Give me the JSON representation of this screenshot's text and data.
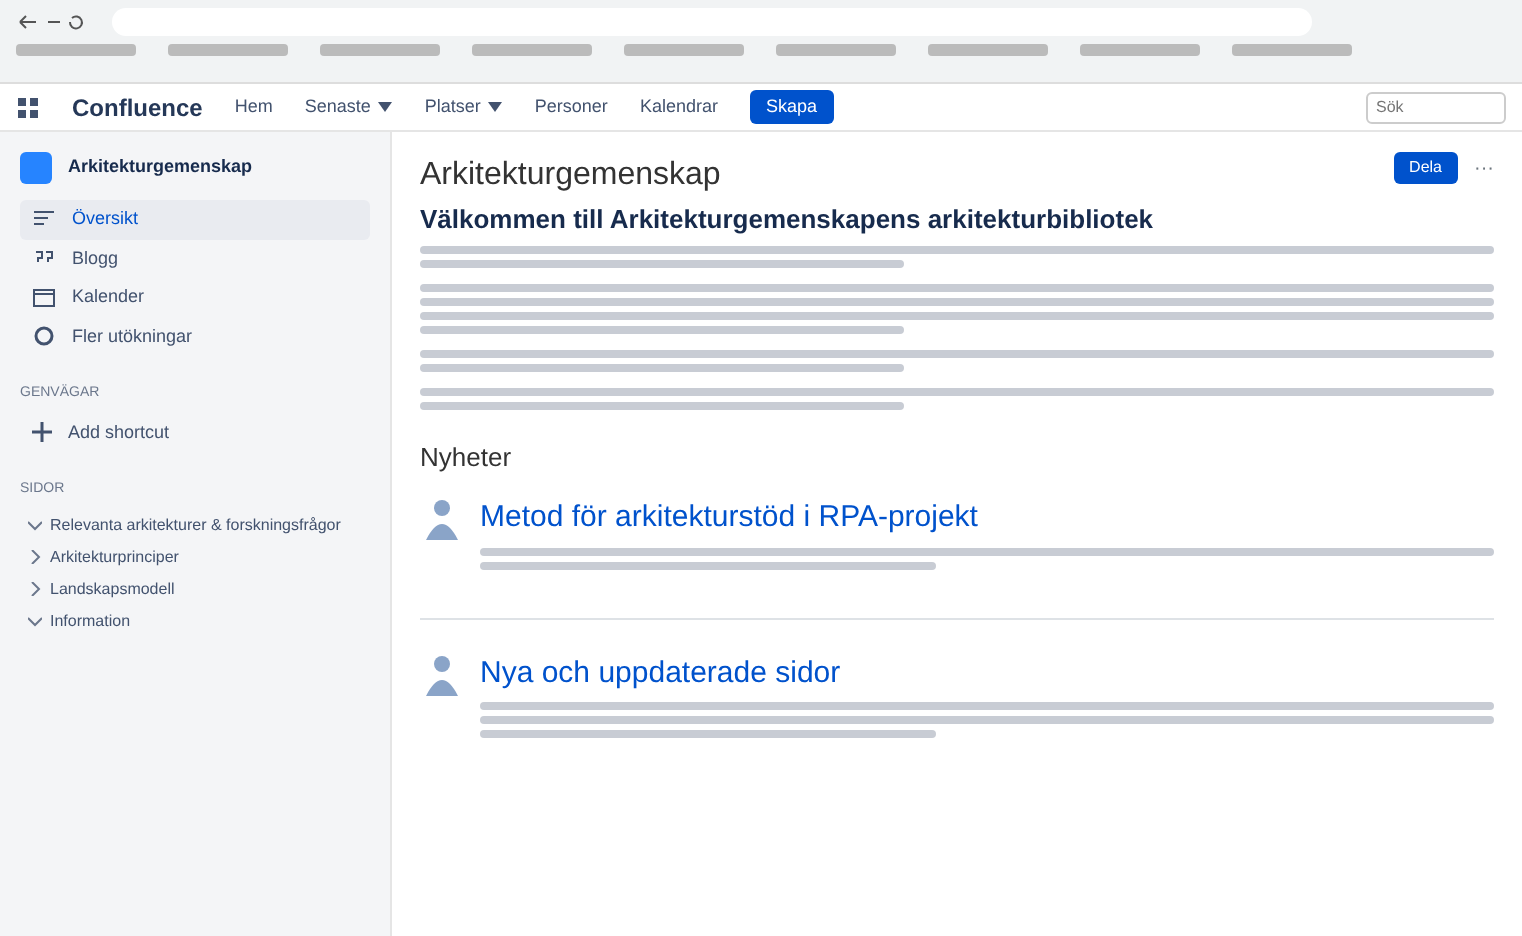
{
  "header": {
    "product": "Confluence",
    "nav": [
      {
        "label": "Hem",
        "dropdown": false
      },
      {
        "label": "Senaste",
        "dropdown": true
      },
      {
        "label": "Platser",
        "dropdown": true
      },
      {
        "label": "Personer",
        "dropdown": false
      },
      {
        "label": "Kalendrar",
        "dropdown": false
      }
    ],
    "create": "Skapa",
    "search": {
      "placeholder": "Sök"
    }
  },
  "sidebar": {
    "space": "Arkitekturgemenskap",
    "items": [
      {
        "label": "Översikt",
        "kind": "overview",
        "selected": true
      },
      {
        "label": "Blogg",
        "kind": "quote",
        "selected": false
      },
      {
        "label": "Kalender",
        "kind": "calendar",
        "selected": false
      },
      {
        "label": "Fler utökningar",
        "kind": "circle",
        "selected": false
      }
    ],
    "shortcuts_heading": "GENVÄGAR",
    "add_shortcut": "Add shortcut",
    "tree_heading": "SIDOR",
    "tree": [
      {
        "label": "Relevanta arkitekturer & forskningsfrågor",
        "expanded": true
      },
      {
        "label": "Arkitekturprinciper",
        "expanded": false
      },
      {
        "label": "Landskapsmodell",
        "expanded": false
      },
      {
        "label": "Information",
        "expanded": true
      }
    ]
  },
  "page": {
    "space": "Arkitekturgemenskap",
    "title": "Välkommen till Arkitekturgemenskapens arkitekturbibliotek",
    "share": "Dela",
    "more": "···",
    "news_heading": "Nyheter",
    "posts": [
      {
        "title": "Metod för arkitekturstöd i RPA-projekt"
      },
      {
        "title": "Nya och uppdaterade sidor"
      }
    ]
  }
}
